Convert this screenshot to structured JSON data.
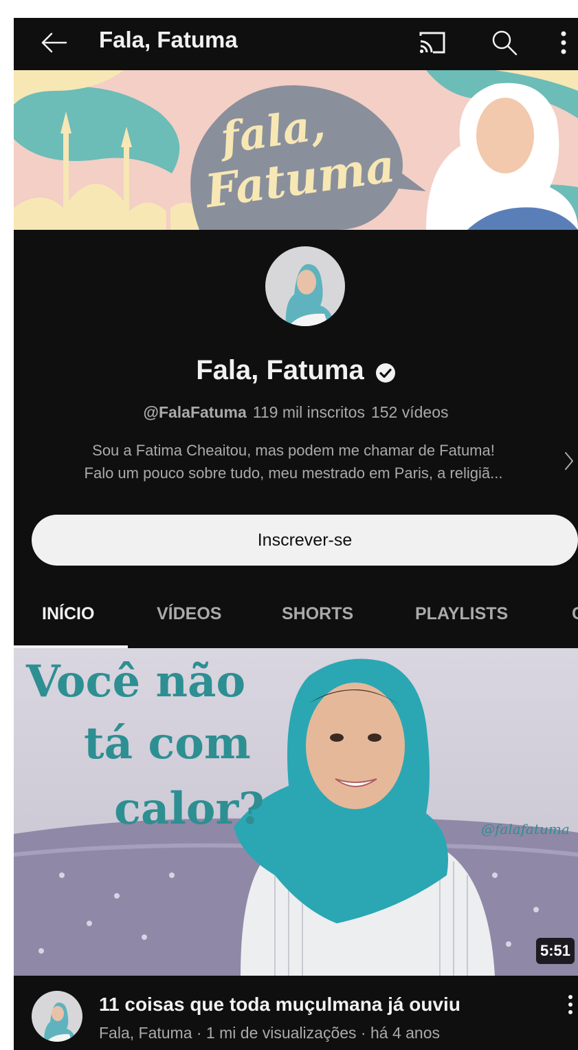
{
  "header": {
    "title": "Fala, Fatuma",
    "icons": [
      "back-arrow-icon",
      "cast-icon",
      "search-icon",
      "more-vert-icon"
    ]
  },
  "banner": {
    "logo_line1": "fala,",
    "logo_line2": "Fatuma"
  },
  "channel": {
    "name": "Fala, Fatuma",
    "verified": true,
    "handle": "@FalaFatuma",
    "subscribers": "119 mil inscritos",
    "videos": "152 vídeos",
    "description_line1": "Sou a Fatima Cheaitou, mas podem me chamar de Fatuma!",
    "description_line2": "Falo um pouco sobre tudo, meu mestrado em Paris, a religiã..."
  },
  "subscribe": {
    "label": "Inscrever-se"
  },
  "tabs": [
    {
      "label": "INÍCIO",
      "active": true
    },
    {
      "label": "VÍDEOS",
      "active": false
    },
    {
      "label": "SHORTS",
      "active": false
    },
    {
      "label": "PLAYLISTS",
      "active": false
    },
    {
      "label": "C",
      "active": false
    }
  ],
  "featured_video": {
    "thumb_line1": "Você não",
    "thumb_line2": "tá com",
    "thumb_line3": "calor?",
    "thumb_watermark": "@falafatuma",
    "duration": "5:51",
    "title": "11 coisas que toda muçulmana já ouviu",
    "meta": "Fala, Fatuma · 1 mi de visualizações · há 4 anos"
  },
  "colors": {
    "background": "#0f0f0f",
    "text_primary": "#f1f1f1",
    "text_secondary": "#aaaaaa",
    "subscribe_bg": "#f1f1f1",
    "banner_teal": "#6cbcb8",
    "banner_pink": "#f3cfc6",
    "banner_gray": "#8a8f9c",
    "thumb_teal": "#2d8f92"
  }
}
